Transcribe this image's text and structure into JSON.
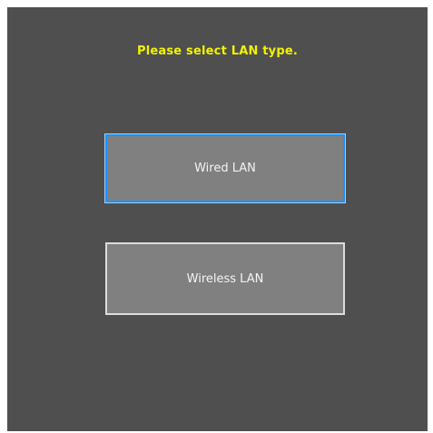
{
  "dialog": {
    "title": "Please select LAN type.",
    "options": [
      {
        "label": "Wired LAN",
        "focused": true
      },
      {
        "label": "Wireless LAN",
        "focused": false
      }
    ]
  },
  "colors": {
    "background": "#4f4f4f",
    "title": "#f2f200",
    "button_fill": "#808080",
    "focus_border": "#1e90ff",
    "button_border": "#dcdcdc"
  }
}
